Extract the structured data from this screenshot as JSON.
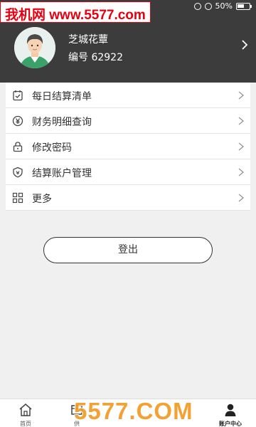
{
  "watermark": {
    "text": "我机网 www.5577.com"
  },
  "statusbar": {
    "battery": "50%"
  },
  "profile": {
    "name": "芝城花蕈",
    "number": "编号 62922"
  },
  "menu": [
    {
      "label": "每日结算清单",
      "icon": "calendar-check-icon"
    },
    {
      "label": "财务明细查询",
      "icon": "yuan-coin-icon"
    },
    {
      "label": "修改密码",
      "icon": "lock-icon"
    },
    {
      "label": "结算账户管理",
      "icon": "shield-icon"
    },
    {
      "label": "更多",
      "icon": "grid-icon"
    }
  ],
  "logout": {
    "label": "登出"
  },
  "bottom_nav": [
    {
      "label": "首页",
      "icon": "home-icon"
    },
    {
      "label": "供",
      "icon": "supply-icon"
    },
    {
      "label": "",
      "icon": "hidden-icon"
    },
    {
      "label": "",
      "icon": "hidden-icon"
    },
    {
      "label": "账户中心",
      "icon": "user-icon",
      "active": true
    }
  ],
  "bottom_watermark": {
    "text": "5577.COM"
  },
  "colors": {
    "header_bg": "#3c3c3c",
    "page_bg": "#f0f0f0",
    "watermark_red": "#e60012",
    "watermark_orange": "#f39a22"
  }
}
